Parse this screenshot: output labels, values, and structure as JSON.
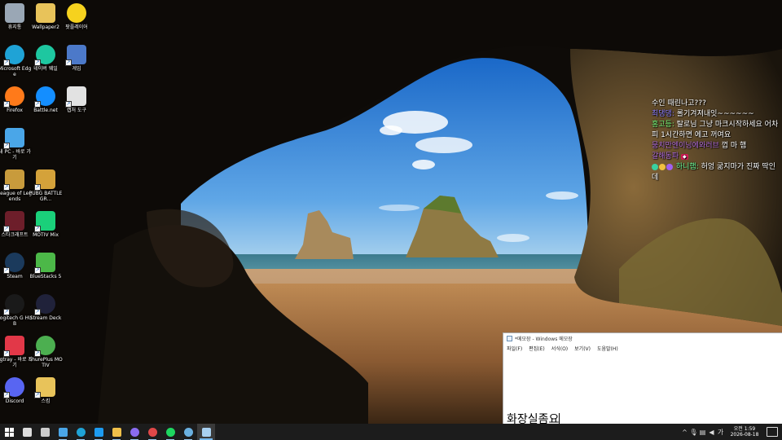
{
  "desktop": {
    "icons": [
      {
        "label": "휴지통",
        "icon": "recycle-bin-icon",
        "color": "#9aa7b5"
      },
      {
        "label": "Wallpaper2",
        "icon": "folder-icon",
        "color": "#e8c35a"
      },
      {
        "label": "팟플레이어",
        "icon": "potplayer-icon",
        "color": "#f6d21e"
      },
      {
        "label": "Microsoft Edge",
        "icon": "edge-icon",
        "color": "#1fa3d6"
      },
      {
        "label": "네이버 웨일",
        "icon": "whale-icon",
        "color": "#1ec7a0"
      },
      {
        "label": "게임",
        "icon": "game-folder-icon",
        "color": "#4c79c9"
      },
      {
        "label": "Firefox",
        "icon": "firefox-icon",
        "color": "#ff7a1a"
      },
      {
        "label": "Battle.net",
        "icon": "battlenet-icon",
        "color": "#148eff"
      },
      {
        "label": "캡처 도구",
        "icon": "snipping-tool-icon",
        "color": "#e2e2e2"
      },
      {
        "label": "내 PC - 바로 가기",
        "icon": "my-pc-icon",
        "color": "#4aa6e8"
      },
      {
        "label": "League of Legends",
        "icon": "league-of-legends-icon",
        "color": "#c89b3c"
      },
      {
        "label": "PUBG BATTLEGR...",
        "icon": "pubg-icon",
        "color": "#d4a23a"
      },
      {
        "label": "스타크래프트",
        "icon": "starcraft-icon",
        "color": "#6d1e2a"
      },
      {
        "label": "MOTIV Mix",
        "icon": "motiv-mix-icon",
        "color": "#1ad07a"
      },
      {
        "label": "Steam",
        "icon": "steam-icon",
        "color": "#1b3a5c"
      },
      {
        "label": "BlueStacks 5",
        "icon": "bluestacks-icon",
        "color": "#4cb848"
      },
      {
        "label": "Logitech G HUB",
        "icon": "logitech-ghub-icon",
        "color": "#1a1a1a"
      },
      {
        "label": "Stream Deck",
        "icon": "stream-deck-icon",
        "color": "#20223a"
      },
      {
        "label": "vgtray - 바로 가기",
        "icon": "vanguard-icon",
        "color": "#e23848"
      },
      {
        "label": "ShurePlus MOTIV",
        "icon": "shureplus-icon",
        "color": "#4caf50"
      },
      {
        "label": "Discord",
        "icon": "discord-icon",
        "color": "#5865f2"
      },
      {
        "label": "스킴",
        "icon": "folder-icon",
        "color": "#e8c35a"
      }
    ]
  },
  "chat": {
    "lines": [
      {
        "nick": "",
        "text": "수인 때린나고???"
      },
      {
        "nick": "최댕댕:",
        "text": " 롤기겨져내잇~~~~~~"
      },
      {
        "nick": "홍고등:",
        "text": " 탈로님 그냥 마크시작하세요 어차피 1시간하면 에고 꺼여요"
      },
      {
        "nick": "뭉치만엔이닝에와러브",
        "text": " 껍 마 햄"
      },
      {
        "nick": "갈해동파",
        "text": ""
      },
      {
        "nick": "하니햄:",
        "text": " 허엉 굶지마가 진짜 딱인데"
      }
    ]
  },
  "notepad": {
    "title": "*메모장 - Windows 메모장",
    "menu": [
      "파일(F)",
      "편집(E)",
      "서식(O)",
      "보기(V)",
      "도움말(H)"
    ],
    "content": "화장실좀요"
  },
  "taskbar": {
    "apps": [
      {
        "icon": "start-icon",
        "color": "#ffffff"
      },
      {
        "icon": "task-view-icon",
        "color": "#dddddd"
      },
      {
        "icon": "calculator-icon",
        "color": "#cccccc"
      },
      {
        "icon": "snipping-app-icon",
        "color": "#4aa6e8"
      },
      {
        "icon": "edge-taskbar-icon",
        "color": "#1fa3d6"
      },
      {
        "icon": "twitter-icon",
        "color": "#1d9bf0"
      },
      {
        "icon": "explorer-icon",
        "color": "#f0c04a"
      },
      {
        "icon": "streaming-app-icon",
        "color": "#8a6cf0"
      },
      {
        "icon": "obs-icon",
        "color": "#e04848"
      },
      {
        "icon": "spotify-icon",
        "color": "#1ed760"
      },
      {
        "icon": "steam-taskbar-icon",
        "color": "#6ab0e0"
      },
      {
        "icon": "notepad-taskbar-icon",
        "color": "#a8d0f0"
      }
    ],
    "tray": {
      "ime": "가",
      "time": "오전 1:59",
      "date": "2026-08-18"
    }
  }
}
